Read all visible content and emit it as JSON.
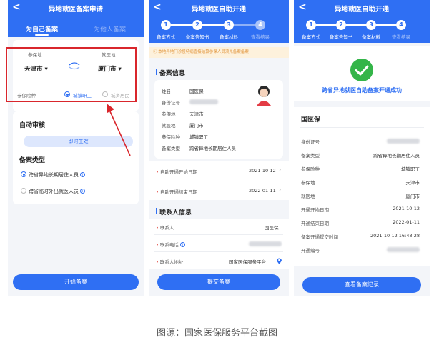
{
  "phone1": {
    "back": "<",
    "title": "异地就医备案申请",
    "tabs": [
      "为自己备案",
      "为他人备案"
    ],
    "insured_label": "参保地",
    "treat_label": "就医地",
    "insured_city": "天津市 ▾",
    "treat_city": "厦门市 ▾",
    "ins_type_label": "参保险种",
    "ins_options": [
      "城镇职工",
      "城乡居民"
    ],
    "auto_review": "自动审核",
    "effective": "即时生效",
    "record_type": "备案类型",
    "types": [
      "跨省异地长期居住人员",
      "跨省临时外出就医人员"
    ],
    "start_btn": "开始备案"
  },
  "phone2": {
    "back": "<",
    "title": "异地就医自助开通",
    "steps": [
      "1",
      "2",
      "3",
      "4"
    ],
    "step_labels": [
      "备案方式",
      "备案告知书",
      "备案材料",
      "查看结果"
    ],
    "notice": "本地异地门诊慢特病直接结算参保人员须先备案备案",
    "section1": "备案信息",
    "info": [
      {
        "k": "姓名",
        "v": "国医保"
      },
      {
        "k": "身份证号",
        "v": ""
      },
      {
        "k": "参保地",
        "v": "天津市"
      },
      {
        "k": "就医地",
        "v": "厦门市"
      },
      {
        "k": "参保险种",
        "v": "城镇职工"
      },
      {
        "k": "备案类型",
        "v": "跨省异地长期居住人员"
      }
    ],
    "start_date_label": "自助开通开始日期",
    "start_date": "2021-10-12",
    "end_date_label": "自助开通结束日期",
    "end_date": "2022-01-11",
    "section2": "联系人信息",
    "contact_label": "联系人",
    "contact": "国医保",
    "phone_label": "联系电话",
    "addr_label": "联系人地址",
    "addr": "国家医保服务平台",
    "submit": "提交备案"
  },
  "phone3": {
    "back": "<",
    "title": "异地就医自助开通",
    "steps": [
      "1",
      "2",
      "3",
      "4"
    ],
    "step_labels": [
      "备案方式",
      "备案告知书",
      "备案材料",
      "查看结果"
    ],
    "success": "跨省异地就医自助备案开通成功",
    "name": "国医保",
    "rows": [
      {
        "k": "身份证号",
        "v": ""
      },
      {
        "k": "备案类型",
        "v": "跨省异地长期居住人员"
      },
      {
        "k": "参保险种",
        "v": "城镇职工"
      },
      {
        "k": "参保地",
        "v": "天津市"
      },
      {
        "k": "就医地",
        "v": "厦门市"
      },
      {
        "k": "开通开始日期",
        "v": "2021-10-12"
      },
      {
        "k": "开通结束日期",
        "v": "2022-01-11"
      },
      {
        "k": "备案开通提交时间",
        "v": "2021-10-12 16:48:28"
      },
      {
        "k": "开通编号",
        "v": ""
      }
    ],
    "view_btn": "查看备案记录"
  },
  "caption": "图源：国家医保服务平台截图",
  "colors": {
    "primary": "#2f6ff3",
    "success": "#34b549",
    "highlight": "#d9262c"
  }
}
